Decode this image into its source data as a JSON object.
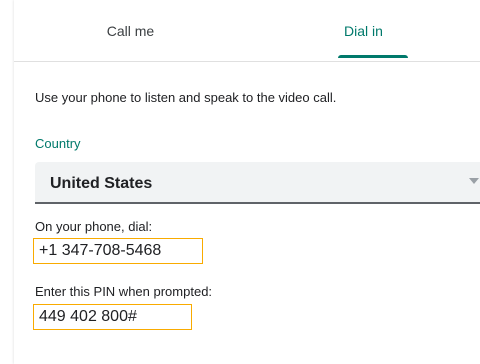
{
  "tabs": [
    {
      "label": "Call me",
      "selected": false
    },
    {
      "label": "Dial in",
      "selected": true
    }
  ],
  "instructions": "Use your phone to listen and speak to the video call.",
  "country": {
    "label": "Country",
    "selected": "United States",
    "icon": "dropdown-arrow-icon"
  },
  "dial": {
    "label": "On your phone, dial:",
    "number": "+1 347-708-5468"
  },
  "pin": {
    "label": "Enter this PIN when prompted:",
    "value": "449 402 800#"
  },
  "colors": {
    "accent": "#00796b",
    "highlight": "#f9ab00",
    "field_bg": "#f1f3f4"
  }
}
